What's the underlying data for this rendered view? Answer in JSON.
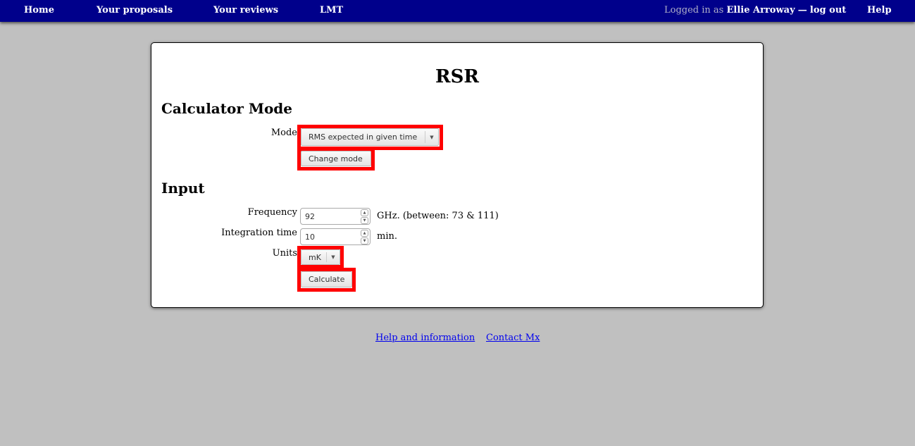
{
  "nav": {
    "home": "Home",
    "proposals": "Your proposals",
    "reviews": "Your reviews",
    "lmt": "LMT",
    "logged_prefix": "Logged in as",
    "user": "Ellie Arroway",
    "separator": "—",
    "logout": "log out",
    "help": "Help"
  },
  "page": {
    "title": "RSR"
  },
  "calculator": {
    "heading": "Calculator Mode",
    "mode_label": "Mode",
    "mode_value": "RMS expected in given time",
    "change_mode": "Change mode"
  },
  "input": {
    "heading": "Input",
    "frequency_label": "Frequency",
    "frequency_value": "92",
    "frequency_unit": "GHz. (between: 73 & 111)",
    "time_label": "Integration time",
    "time_value": "10",
    "time_unit": "min.",
    "units_label": "Units",
    "units_value": "mK",
    "calculate": "Calculate"
  },
  "footer": {
    "help": "Help and information",
    "contact": "Contact Mx"
  },
  "colors": {
    "navbar": "#00008b",
    "highlight": "#ff0000",
    "background": "#c0c0c0"
  }
}
